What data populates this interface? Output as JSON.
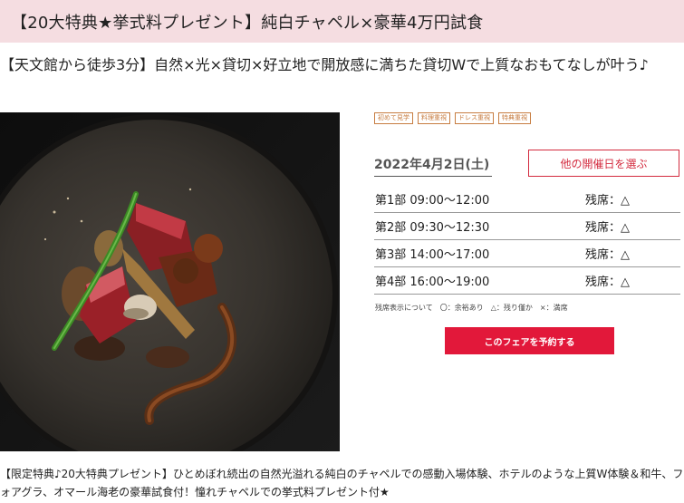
{
  "header": {
    "title": "【20大特典★挙式料プレゼント】純白チャペル×豪華4万円試食"
  },
  "subhead": "【天文館から徒歩3分】自然×光×貸切×好立地で開放感に満ちた貸切Wで上質なおもてなしが叶う♪",
  "tags": [
    "初めて見学",
    "料理重視",
    "ドレス重視",
    "特典重視"
  ],
  "event": {
    "date": "2022年4月2日(土)",
    "other_dates_label": "他の開催日を選ぶ",
    "slots": [
      {
        "time": "第1部 09:00～12:00",
        "status": "残席：△"
      },
      {
        "time": "第2部 09:30～12:30",
        "status": "残席：△"
      },
      {
        "time": "第3部 14:00～17:00",
        "status": "残席：△"
      },
      {
        "time": "第4部 16:00～19:00",
        "status": "残席：△"
      }
    ],
    "legend": "残席表示について　〇：余裕あり　△：残り僅か　×：満席",
    "reserve_label": "このフェアを予約する"
  },
  "description": "【限定特典♪20大特典プレゼント】ひとめぼれ続出の自然光溢れる純白のチャペルでの感動入場体験、ホテルのような上質W体験＆和牛、フォアグラ、オマール海老の豪華試食付！憧れチャペルでの挙式料プレゼント付★",
  "colors": {
    "header_bg": "#f5dde1",
    "accent_red": "#e2183a",
    "tag_color": "#c77d41"
  }
}
